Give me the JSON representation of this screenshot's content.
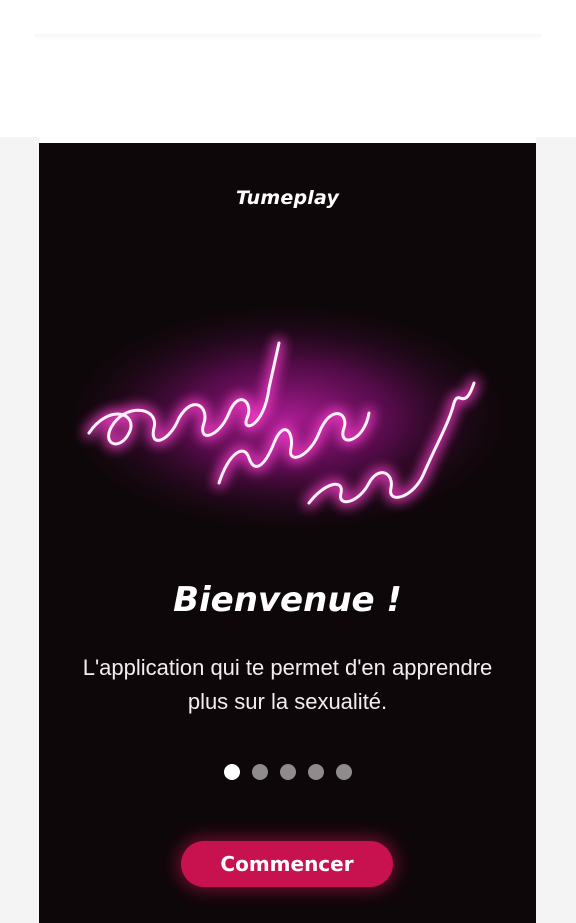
{
  "app": {
    "logo_text": "Tumeplay"
  },
  "hero": {
    "neon_text": "good vibes only",
    "neon_color": "#ff4fd8"
  },
  "onboarding": {
    "title": "Bienvenue !",
    "subtitle": "L'application qui te permet d'en apprendre plus sur la sexualité.",
    "page_indicator": {
      "total": 5,
      "active_index": 0
    },
    "cta_label": "Commencer",
    "cta_color": "#c8124f"
  }
}
